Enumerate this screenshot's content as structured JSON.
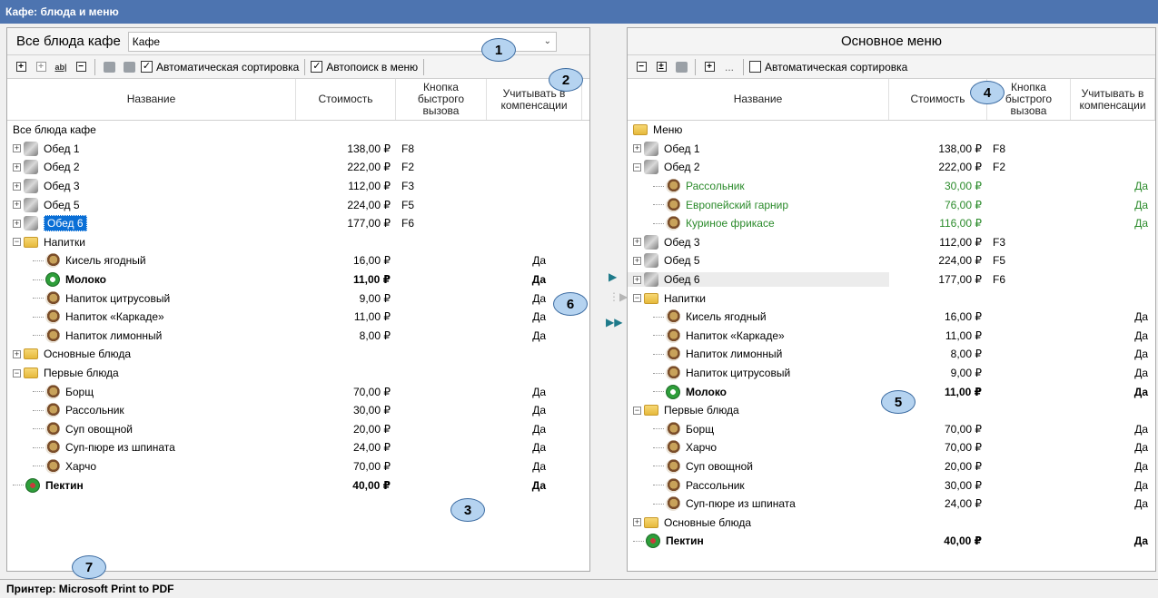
{
  "window": {
    "title": "Кафе: блюда и меню"
  },
  "left": {
    "label": "Все блюда кафе",
    "combo_value": "Кафе",
    "toolbar": {
      "auto_sort": "Автоматическая сортировка",
      "auto_search": "Автопоиск в меню"
    },
    "columns": [
      "Название",
      "Стоимость",
      "Кнопка быстрого вызова",
      "Учитывать в компенсации"
    ],
    "rows": [
      {
        "name": "Все блюда кафе",
        "cost": "",
        "key": "",
        "comp": ""
      },
      {
        "name": "Обед 1",
        "cost": "138,00 ₽",
        "key": "F8",
        "comp": ""
      },
      {
        "name": "Обед 2",
        "cost": "222,00 ₽",
        "key": "F2",
        "comp": ""
      },
      {
        "name": "Обед 3",
        "cost": "112,00 ₽",
        "key": "F3",
        "comp": ""
      },
      {
        "name": "Обед 5",
        "cost": "224,00 ₽",
        "key": "F5",
        "comp": ""
      },
      {
        "name": "Обед 6",
        "cost": "177,00 ₽",
        "key": "F6",
        "comp": ""
      },
      {
        "name": "Напитки",
        "cost": "",
        "key": "",
        "comp": ""
      },
      {
        "name": "Кисель ягодный",
        "cost": "16,00 ₽",
        "key": "",
        "comp": "Да"
      },
      {
        "name": "Молоко",
        "cost": "11,00 ₽",
        "key": "",
        "comp": "Да"
      },
      {
        "name": "Напиток  цитрусовый",
        "cost": "9,00 ₽",
        "key": "",
        "comp": "Да"
      },
      {
        "name": "Напиток «Каркаде»",
        "cost": "11,00 ₽",
        "key": "",
        "comp": "Да"
      },
      {
        "name": "Напиток лимонный",
        "cost": "8,00 ₽",
        "key": "",
        "comp": "Да"
      },
      {
        "name": "Основные блюда",
        "cost": "",
        "key": "",
        "comp": ""
      },
      {
        "name": "Первые блюда",
        "cost": "",
        "key": "",
        "comp": ""
      },
      {
        "name": "Борщ",
        "cost": "70,00 ₽",
        "key": "",
        "comp": "Да"
      },
      {
        "name": "Рассольник",
        "cost": "30,00 ₽",
        "key": "",
        "comp": "Да"
      },
      {
        "name": "Суп овощной",
        "cost": "20,00 ₽",
        "key": "",
        "comp": "Да"
      },
      {
        "name": "Суп-пюре из шпината",
        "cost": "24,00 ₽",
        "key": "",
        "comp": "Да"
      },
      {
        "name": "Харчо",
        "cost": "70,00 ₽",
        "key": "",
        "comp": "Да"
      },
      {
        "name": "Пектин",
        "cost": "40,00 ₽",
        "key": "",
        "comp": "Да"
      }
    ]
  },
  "right": {
    "title": "Основное меню",
    "toolbar": {
      "dots": "...",
      "auto_sort": "Автоматическая сортировка"
    },
    "columns": [
      "Название",
      "Стоимость",
      "Кнопка быстрого вызова",
      "Учитывать в компенсации"
    ],
    "rows": [
      {
        "name": "Меню",
        "cost": "",
        "key": "",
        "comp": ""
      },
      {
        "name": "Обед 1",
        "cost": "138,00 ₽",
        "key": "F8",
        "comp": ""
      },
      {
        "name": "Обед 2",
        "cost": "222,00 ₽",
        "key": "F2",
        "comp": ""
      },
      {
        "name": "Рассольник",
        "cost": "30,00 ₽",
        "key": "",
        "comp": "Да"
      },
      {
        "name": "Европейский гарнир",
        "cost": "76,00 ₽",
        "key": "",
        "comp": "Да"
      },
      {
        "name": "Куриное фрикасе",
        "cost": "116,00 ₽",
        "key": "",
        "comp": "Да"
      },
      {
        "name": "Обед 3",
        "cost": "112,00 ₽",
        "key": "F3",
        "comp": ""
      },
      {
        "name": "Обед 5",
        "cost": "224,00 ₽",
        "key": "F5",
        "comp": ""
      },
      {
        "name": "Обед 6",
        "cost": "177,00 ₽",
        "key": "F6",
        "comp": ""
      },
      {
        "name": "Напитки",
        "cost": "",
        "key": "",
        "comp": ""
      },
      {
        "name": "Кисель ягодный",
        "cost": "16,00 ₽",
        "key": "",
        "comp": "Да"
      },
      {
        "name": "Напиток «Каркаде»",
        "cost": "11,00 ₽",
        "key": "",
        "comp": "Да"
      },
      {
        "name": "Напиток лимонный",
        "cost": "8,00 ₽",
        "key": "",
        "comp": "Да"
      },
      {
        "name": "Напиток  цитрусовый",
        "cost": "9,00 ₽",
        "key": "",
        "comp": "Да"
      },
      {
        "name": "Молоко",
        "cost": "11,00 ₽",
        "key": "",
        "comp": "Да"
      },
      {
        "name": "Первые блюда",
        "cost": "",
        "key": "",
        "comp": ""
      },
      {
        "name": "Борщ",
        "cost": "70,00 ₽",
        "key": "",
        "comp": "Да"
      },
      {
        "name": "Харчо",
        "cost": "70,00 ₽",
        "key": "",
        "comp": "Да"
      },
      {
        "name": "Суп овощной",
        "cost": "20,00 ₽",
        "key": "",
        "comp": "Да"
      },
      {
        "name": "Рассольник",
        "cost": "30,00 ₽",
        "key": "",
        "comp": "Да"
      },
      {
        "name": "Суп-пюре из шпината",
        "cost": "24,00 ₽",
        "key": "",
        "comp": "Да"
      },
      {
        "name": "Основные блюда",
        "cost": "",
        "key": "",
        "comp": ""
      },
      {
        "name": "Пектин",
        "cost": "40,00 ₽",
        "key": "",
        "comp": "Да"
      }
    ]
  },
  "callouts": [
    "1",
    "2",
    "3",
    "4",
    "5",
    "6",
    "7"
  ],
  "status": {
    "printer": "Принтер: Microsoft Print to PDF"
  },
  "colors": {
    "titlebar": "#4d74b0",
    "selection": "#0a6fd6",
    "green_text": "#2a8a2a",
    "callout_fill": "#b5d3f0"
  }
}
